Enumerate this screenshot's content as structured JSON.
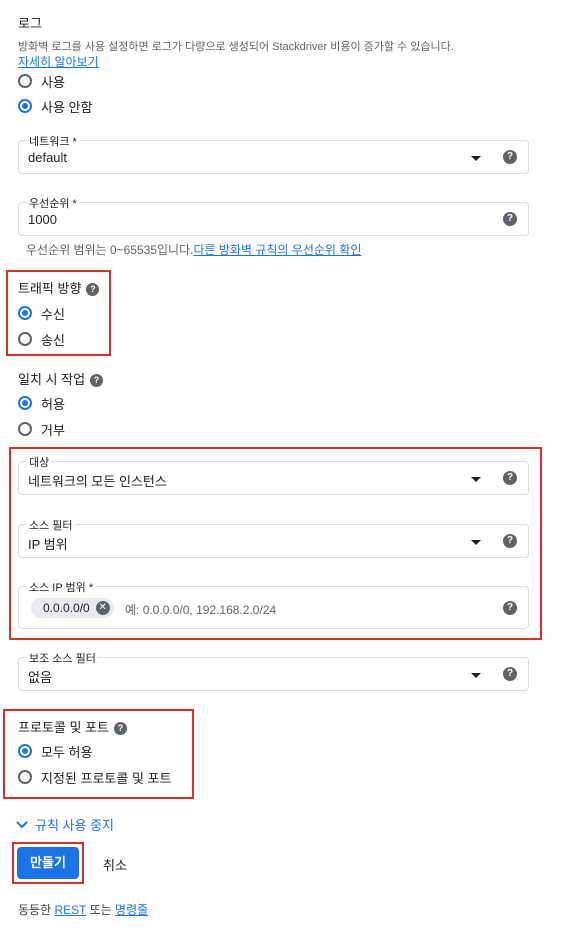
{
  "logs": {
    "title": "로그",
    "description": "방화벽 로그를 사용 설정하면 로그가 다량으로 생성되어 Stackdriver 비용이 증가할 수 있습니다.",
    "learn_more": "자세히 알아보기",
    "options": [
      {
        "label": "사용",
        "checked": false
      },
      {
        "label": "사용 안함",
        "checked": true
      }
    ]
  },
  "network": {
    "label": "네트워크 *",
    "value": "default"
  },
  "priority": {
    "label": "우선순위 *",
    "value": "1000",
    "hint": "우선순위 범위는 0~65535입니다.",
    "hint_link": "다른 방화벽 규칙의 우선순위 확인"
  },
  "direction": {
    "title": "트래픽 방향",
    "options": [
      {
        "label": "수신",
        "checked": true
      },
      {
        "label": "송신",
        "checked": false
      }
    ]
  },
  "action": {
    "title": "일치 시 작업",
    "options": [
      {
        "label": "허용",
        "checked": true
      },
      {
        "label": "거부",
        "checked": false
      }
    ]
  },
  "targets": {
    "label": "대상",
    "value": "네트워크의 모든 인스턴스"
  },
  "source_filter": {
    "label": "소스 필터",
    "value": "IP 범위"
  },
  "source_ip": {
    "label": "소스 IP 범위 *",
    "chip": "0.0.0.0/0",
    "placeholder": "예: 0.0.0.0/0, 192.168.2.0/24"
  },
  "second_source": {
    "label": "보조 소스 필터",
    "value": "없음"
  },
  "protocols": {
    "title": "프로토콜 및 포트",
    "options": [
      {
        "label": "모두 허용",
        "checked": true
      },
      {
        "label": "지정된 프로토콜 및 포트",
        "checked": false
      }
    ]
  },
  "disable_rule": "규칙 사용 중지",
  "buttons": {
    "create": "만들기",
    "cancel": "취소"
  },
  "footer": {
    "prefix": "동등한",
    "rest": "REST",
    "or": "또는",
    "command": "명령줄"
  },
  "colors": {
    "accent": "#1a73e8",
    "highlight": "#d93025"
  },
  "icons": [
    "help-icon",
    "dropdown-caret-icon",
    "chevron-down-icon",
    "chip-remove-icon"
  ]
}
